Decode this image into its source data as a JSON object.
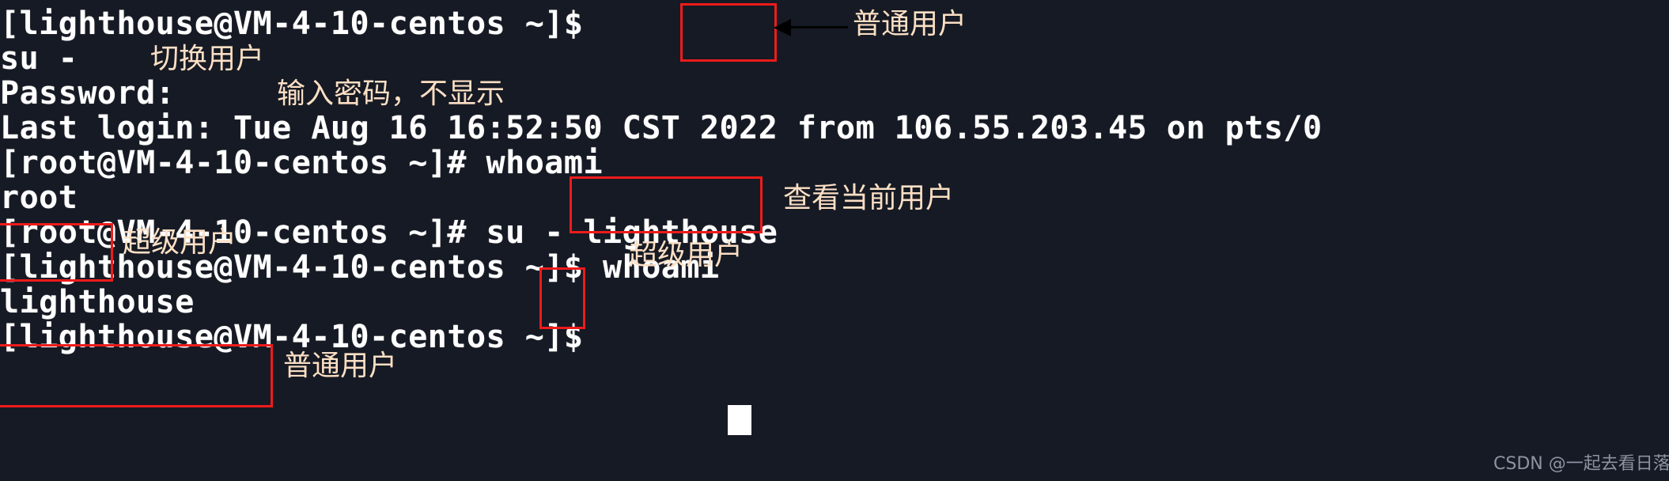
{
  "terminal": {
    "background_color": "#161a24",
    "text_color": "#ffffff",
    "annotation_color": "#fbdfc4",
    "highlight_color": "#ee1b1b",
    "lines": [
      {
        "id": "prompt-user-1",
        "text": "[lighthouse@VM-4-10-centos ~]$"
      },
      {
        "id": "command-su",
        "text": "su -"
      },
      {
        "id": "password-prompt",
        "text": "Password:"
      },
      {
        "id": "last-login",
        "text": "Last login: Tue Aug 16 16:52:50 CST 2022 from 106.55.203.45 on pts/0"
      },
      {
        "id": "prompt-root-1",
        "text": "[root@VM-4-10-centos ~]# whoami"
      },
      {
        "id": "output-root",
        "text": "root"
      },
      {
        "id": "prompt-root-2",
        "text": "[root@VM-4-10-centos ~]# su - lighthouse"
      },
      {
        "id": "prompt-user-2",
        "text": "[lighthouse@VM-4-10-centos ~]$ whoami"
      },
      {
        "id": "output-lighthouse",
        "text": "lighthouse"
      },
      {
        "id": "prompt-user-3",
        "text": "[lighthouse@VM-4-10-centos ~]$"
      }
    ]
  },
  "annotations": [
    {
      "id": "annot-normal-user-1",
      "text": "普通用户"
    },
    {
      "id": "annot-switch-user",
      "text": "切换用户"
    },
    {
      "id": "annot-type-password",
      "text": "输入密码，不显示"
    },
    {
      "id": "annot-check-user",
      "text": "查看当前用户"
    },
    {
      "id": "annot-super-user-1",
      "text": "超级用户"
    },
    {
      "id": "annot-super-user-2",
      "text": "超级用户"
    },
    {
      "id": "annot-normal-user-2",
      "text": "普通用户"
    }
  ],
  "watermark": {
    "text": "CSDN @一起去看日落吗"
  }
}
